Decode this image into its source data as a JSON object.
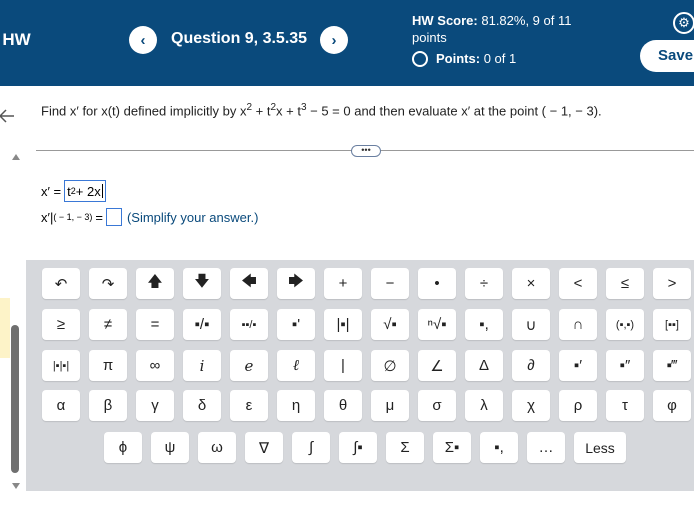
{
  "header": {
    "hw_label": "- HW",
    "prev_glyph": "‹",
    "next_glyph": "›",
    "question_title": "Question 9, 3.5.35",
    "score_label": "HW Score:",
    "score_value": "81.82%, 9 of 11",
    "score_suffix": "points",
    "points_label": "Points:",
    "points_value": "0 of 1",
    "save_label": "Save",
    "brand_color": "#0a4a7c"
  },
  "question": {
    "prefix": "Find x′ for x(t) defined implicitly by x",
    "exp1": "2",
    "mid1": " + t",
    "exp2": "2",
    "mid2": "x + t",
    "exp3": "3",
    "suffix": " − 5 = 0 and then evaluate x′ at the point ( − 1, − 3)."
  },
  "more_pill": "•••",
  "answer": {
    "line1_label": "x′ =",
    "line1_t": "t",
    "line1_exp": "2",
    "line1_rest": " + 2x",
    "line2_label": "x′|",
    "line2_sub": "( − 1, − 3)",
    "line2_eq": "=",
    "simplify_text": "(Simplify your answer.)"
  },
  "keyboard": {
    "row1": [
      "↶",
      "↷",
      "🡅",
      "🡇",
      "🡄",
      "🡆",
      "+",
      "−",
      "•",
      "÷",
      "×",
      "<",
      "≤",
      ">"
    ],
    "row2": [
      "≥",
      "≠",
      "=",
      "▪/▪",
      "▪▪/▪",
      "▪'",
      "|▪|",
      "√▪",
      "ⁿ√▪",
      "▪,",
      "∪",
      "∩",
      "(▪,▪)",
      "[▪▪]"
    ],
    "row3": [
      "|▪|▪|",
      "π",
      "∞",
      "i",
      "e",
      "ℓ",
      "|",
      "∅",
      "∠",
      "Δ",
      "∂",
      "▪′",
      "▪″",
      "▪‴"
    ],
    "row4": [
      "α",
      "β",
      "γ",
      "δ",
      "ε",
      "η",
      "θ",
      "μ",
      "σ",
      "λ",
      "χ",
      "ρ",
      "τ",
      "φ"
    ],
    "row5": [
      "ϕ",
      "ψ",
      "ω",
      "∇",
      "∫",
      "∫▪",
      "Σ",
      "Σ▪",
      "▪,",
      "…",
      "Less"
    ]
  }
}
